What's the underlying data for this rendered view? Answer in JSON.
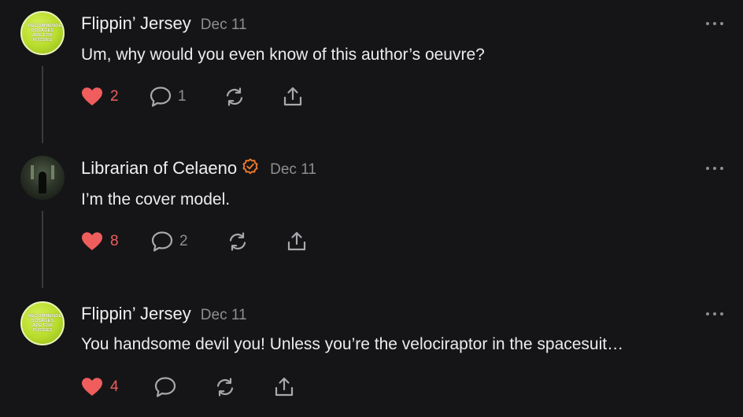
{
  "colors": {
    "background": "#151517",
    "like": "#f05d5d",
    "muted": "#8e8e92",
    "verified": "#f07b2c"
  },
  "comments": [
    {
      "author": "Flippin’ Jersey",
      "date": "Dec 11",
      "text": "Um, why would you even know of this author’s oeuvre?",
      "avatar_text": "RECOMMENDED DOSAGES ARE FOR PUSSIES",
      "likes": "2",
      "replies": "1"
    },
    {
      "author": "Librarian of Celaeno",
      "date": "Dec 11",
      "text": "I’m the cover model.",
      "verified": true,
      "likes": "8",
      "replies": "2"
    },
    {
      "author": "Flippin’ Jersey",
      "date": "Dec 11",
      "text": "You handsome devil you! Unless you’re the velociraptor in the spacesuit…",
      "avatar_text": "RECOMMENDED DOSAGES ARE FOR PUSSIES",
      "likes": "4",
      "replies": ""
    }
  ],
  "icons": [
    "heart-icon",
    "comment-icon",
    "restack-icon",
    "share-icon",
    "more-options-icon",
    "verified-icon"
  ]
}
